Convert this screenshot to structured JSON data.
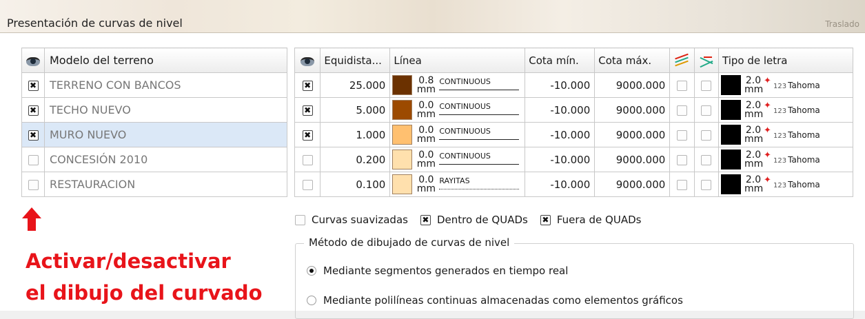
{
  "window": {
    "title": "Presentación de curvas de nivel",
    "ghost_text": "Traslado"
  },
  "left_table": {
    "header": "Modelo del terreno",
    "rows": [
      {
        "checked": true,
        "name": "TERRENO CON BANCOS",
        "selected": false
      },
      {
        "checked": true,
        "name": "TECHO NUEVO",
        "selected": false
      },
      {
        "checked": true,
        "name": "MURO NUEVO",
        "selected": true
      },
      {
        "checked": false,
        "name": "CONCESIÓN 2010",
        "selected": false
      },
      {
        "checked": false,
        "name": "RESTAURACION",
        "selected": false
      }
    ]
  },
  "right_table": {
    "headers": {
      "equidistance": "Equidista...",
      "line": "Línea",
      "min": "Cota mín.",
      "max": "Cota máx.",
      "font": "Tipo de letra"
    },
    "rows": [
      {
        "checked": true,
        "equidistance": "25.000",
        "swatch": "#6b3100",
        "width": "0.8",
        "unit": "mm",
        "linetype": "CONTINUOUS",
        "min": "-10.000",
        "max": "9000.000",
        "font_size": "2.0",
        "font_unit": "mm",
        "font_num": "123",
        "font_name": "Tahoma"
      },
      {
        "checked": true,
        "equidistance": "5.000",
        "swatch": "#9c4a00",
        "width": "0.0",
        "unit": "mm",
        "linetype": "CONTINUOUS",
        "min": "-10.000",
        "max": "9000.000",
        "font_size": "2.0",
        "font_unit": "mm",
        "font_num": "123",
        "font_name": "Tahoma"
      },
      {
        "checked": true,
        "equidistance": "1.000",
        "swatch": "#ffc070",
        "width": "0.0",
        "unit": "mm",
        "linetype": "CONTINUOUS",
        "min": "-10.000",
        "max": "9000.000",
        "font_size": "2.0",
        "font_unit": "mm",
        "font_num": "123",
        "font_name": "Tahoma"
      },
      {
        "checked": false,
        "equidistance": "0.200",
        "swatch": "#ffe0ad",
        "width": "0.0",
        "unit": "mm",
        "linetype": "CONTINUOUS",
        "min": "-10.000",
        "max": "9000.000",
        "font_size": "2.0",
        "font_unit": "mm",
        "font_num": "123",
        "font_name": "Tahoma"
      },
      {
        "checked": false,
        "equidistance": "0.100",
        "swatch": "#ffe0ad",
        "width": "0.0",
        "unit": "mm",
        "linetype": "RAYITAS",
        "min": "-10.000",
        "max": "9000.000",
        "font_size": "2.0",
        "font_unit": "mm",
        "font_num": "123",
        "font_name": "Tahoma"
      }
    ]
  },
  "options": {
    "smooth": {
      "label": "Curvas suavizadas",
      "checked": false
    },
    "inside": {
      "label": "Dentro de QUADs",
      "checked": true
    },
    "outside": {
      "label": "Fuera de QUADs",
      "checked": true
    }
  },
  "method_group": {
    "legend": "Método de dibujado de curvas de nivel",
    "option1": {
      "label": "Mediante segmentos generados en tiempo real",
      "selected": true
    },
    "option2": {
      "label": "Mediante polilíneas continuas almacenadas como elementos gráficos",
      "selected": false
    }
  },
  "annotation": {
    "line1": "Activar/desactivar",
    "line2": "el dibujo del curvado",
    "color": "#e8141a"
  }
}
